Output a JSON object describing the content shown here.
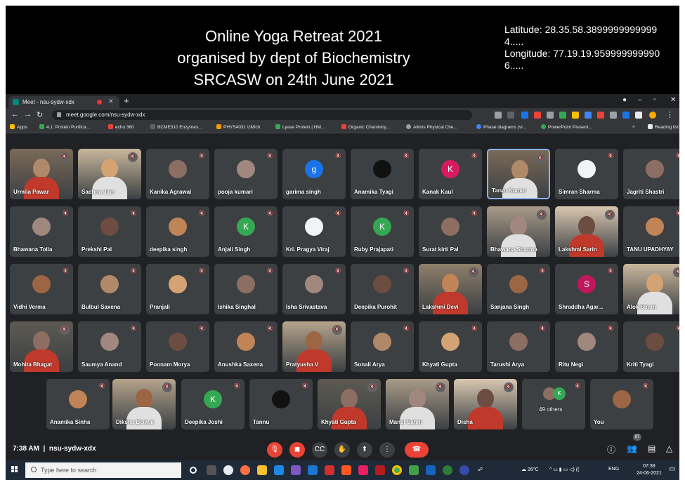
{
  "caption": {
    "title_lines": [
      "Online Yoga Retreat 2021",
      "organised by dept of Biochemistry",
      "SRCASW on 24th June 2021"
    ],
    "latitude": "Latitude: 28.35.58.38999999999994.....",
    "longitude": "Longitude: 77.19.19.9599999999906....."
  },
  "browser": {
    "tab_title": "Meet - nsu-sydw-xdx",
    "url": "meet.google.com/nsu-sydw-xdx",
    "bookmarks": [
      "Apps",
      "4.1: Protein Purifica...",
      "echo 360",
      "BCME310 Enzymes...",
      "PHYS4031 UMich",
      "Lyase Protein | HM...",
      "Organic Chemistry...",
      "Atkins Physical Che...",
      "Phase diagrams (vi...",
      "PowerPoint Present...",
      "Reading list"
    ]
  },
  "participants": [
    {
      "name": "Urmila Pawar",
      "kind": "video"
    },
    {
      "name": "Sadhna Jain",
      "kind": "video"
    },
    {
      "name": "Kanika Agrawal",
      "kind": "photo"
    },
    {
      "name": "pooja kumari",
      "kind": "photo"
    },
    {
      "name": "garima singh",
      "kind": "letter",
      "letter": "g"
    },
    {
      "name": "Anamika Tyagi",
      "kind": "photo"
    },
    {
      "name": "Kanak Kaul",
      "kind": "letter",
      "letter": "K"
    },
    {
      "name": "Tarun Kumar",
      "kind": "video"
    },
    {
      "name": "Simran Sharma",
      "kind": "photo"
    },
    {
      "name": "Jagriti Shastri",
      "kind": "photo"
    },
    {
      "name": "Bhawana Tolia",
      "kind": "photo"
    },
    {
      "name": "Prekshi Pal",
      "kind": "photo"
    },
    {
      "name": "deepika singh",
      "kind": "photo"
    },
    {
      "name": "Anjali Singh",
      "kind": "letter",
      "letter": "K"
    },
    {
      "name": "Kri. Pragya Viraj",
      "kind": "photo"
    },
    {
      "name": "Ruby Prajapati",
      "kind": "letter",
      "letter": "K"
    },
    {
      "name": "Surat kirti Pal",
      "kind": "photo"
    },
    {
      "name": "Bhawana Sharma",
      "kind": "video"
    },
    {
      "name": "Lakshmi Sarin",
      "kind": "video"
    },
    {
      "name": "TANU UPADHYAY",
      "kind": "photo"
    },
    {
      "name": "Vidhi Verma",
      "kind": "photo"
    },
    {
      "name": "Bulbul Saxena",
      "kind": "photo"
    },
    {
      "name": "Pranjali",
      "kind": "photo"
    },
    {
      "name": "Ishika Singhal",
      "kind": "photo"
    },
    {
      "name": "Isha Srivastava",
      "kind": "photo"
    },
    {
      "name": "Deepika Purohit",
      "kind": "photo"
    },
    {
      "name": "Lakshmi Devi",
      "kind": "video"
    },
    {
      "name": "Sanjana Singh",
      "kind": "photo"
    },
    {
      "name": "Shraddha Agar...",
      "kind": "letter",
      "letter": "S"
    },
    {
      "name": "Alok Singh",
      "kind": "video"
    },
    {
      "name": "Mohita Bhagat",
      "kind": "video"
    },
    {
      "name": "Saumya Anand",
      "kind": "photo"
    },
    {
      "name": "Poonam Morya",
      "kind": "photo"
    },
    {
      "name": "Anushka Saxena",
      "kind": "photo"
    },
    {
      "name": "Pratyusha V",
      "kind": "video"
    },
    {
      "name": "Sonali Arya",
      "kind": "photo"
    },
    {
      "name": "Khyati Gupta",
      "kind": "photo"
    },
    {
      "name": "Tarushi Arya",
      "kind": "photo"
    },
    {
      "name": "Ritu Negi",
      "kind": "photo"
    },
    {
      "name": "Kriti Tyagi",
      "kind": "photo"
    },
    {
      "name": "Anamika Sinha",
      "kind": "photo"
    },
    {
      "name": "Diksha Belwal",
      "kind": "video"
    },
    {
      "name": "Deepika Joshi",
      "kind": "letter",
      "letter": "K"
    },
    {
      "name": "Tannu",
      "kind": "photo"
    },
    {
      "name": "Khyati Gupta",
      "kind": "video"
    },
    {
      "name": "Mansi Sahni",
      "kind": "video"
    },
    {
      "name": "Disha",
      "kind": "video"
    },
    {
      "name": "49 others",
      "kind": "others"
    },
    {
      "name": "You",
      "kind": "photo"
    }
  ],
  "others": {
    "letter": "K"
  },
  "meeting": {
    "time": "7:38 AM",
    "code": "nsu-sydw-xdx",
    "participant_count": "97"
  },
  "taskbar": {
    "search_placeholder": "Type here to search",
    "weather": "26°C",
    "lang": "ENG",
    "time": "07:38",
    "date": "24-06-2021"
  },
  "colors": {
    "meet_bg": "#202124",
    "tile_bg": "#3c4043",
    "end_call": "#ea4335",
    "active_speaker": "#8ab4f8"
  }
}
